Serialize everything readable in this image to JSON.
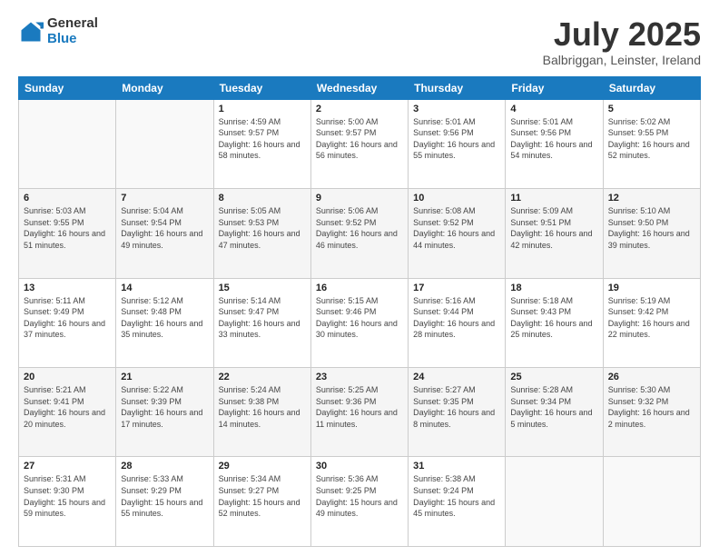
{
  "header": {
    "logo_general": "General",
    "logo_blue": "Blue",
    "month_year": "July 2025",
    "location": "Balbriggan, Leinster, Ireland"
  },
  "weekdays": [
    "Sunday",
    "Monday",
    "Tuesday",
    "Wednesday",
    "Thursday",
    "Friday",
    "Saturday"
  ],
  "weeks": [
    [
      {
        "day": "",
        "info": ""
      },
      {
        "day": "",
        "info": ""
      },
      {
        "day": "1",
        "info": "Sunrise: 4:59 AM\nSunset: 9:57 PM\nDaylight: 16 hours and 58 minutes."
      },
      {
        "day": "2",
        "info": "Sunrise: 5:00 AM\nSunset: 9:57 PM\nDaylight: 16 hours and 56 minutes."
      },
      {
        "day": "3",
        "info": "Sunrise: 5:01 AM\nSunset: 9:56 PM\nDaylight: 16 hours and 55 minutes."
      },
      {
        "day": "4",
        "info": "Sunrise: 5:01 AM\nSunset: 9:56 PM\nDaylight: 16 hours and 54 minutes."
      },
      {
        "day": "5",
        "info": "Sunrise: 5:02 AM\nSunset: 9:55 PM\nDaylight: 16 hours and 52 minutes."
      }
    ],
    [
      {
        "day": "6",
        "info": "Sunrise: 5:03 AM\nSunset: 9:55 PM\nDaylight: 16 hours and 51 minutes."
      },
      {
        "day": "7",
        "info": "Sunrise: 5:04 AM\nSunset: 9:54 PM\nDaylight: 16 hours and 49 minutes."
      },
      {
        "day": "8",
        "info": "Sunrise: 5:05 AM\nSunset: 9:53 PM\nDaylight: 16 hours and 47 minutes."
      },
      {
        "day": "9",
        "info": "Sunrise: 5:06 AM\nSunset: 9:52 PM\nDaylight: 16 hours and 46 minutes."
      },
      {
        "day": "10",
        "info": "Sunrise: 5:08 AM\nSunset: 9:52 PM\nDaylight: 16 hours and 44 minutes."
      },
      {
        "day": "11",
        "info": "Sunrise: 5:09 AM\nSunset: 9:51 PM\nDaylight: 16 hours and 42 minutes."
      },
      {
        "day": "12",
        "info": "Sunrise: 5:10 AM\nSunset: 9:50 PM\nDaylight: 16 hours and 39 minutes."
      }
    ],
    [
      {
        "day": "13",
        "info": "Sunrise: 5:11 AM\nSunset: 9:49 PM\nDaylight: 16 hours and 37 minutes."
      },
      {
        "day": "14",
        "info": "Sunrise: 5:12 AM\nSunset: 9:48 PM\nDaylight: 16 hours and 35 minutes."
      },
      {
        "day": "15",
        "info": "Sunrise: 5:14 AM\nSunset: 9:47 PM\nDaylight: 16 hours and 33 minutes."
      },
      {
        "day": "16",
        "info": "Sunrise: 5:15 AM\nSunset: 9:46 PM\nDaylight: 16 hours and 30 minutes."
      },
      {
        "day": "17",
        "info": "Sunrise: 5:16 AM\nSunset: 9:44 PM\nDaylight: 16 hours and 28 minutes."
      },
      {
        "day": "18",
        "info": "Sunrise: 5:18 AM\nSunset: 9:43 PM\nDaylight: 16 hours and 25 minutes."
      },
      {
        "day": "19",
        "info": "Sunrise: 5:19 AM\nSunset: 9:42 PM\nDaylight: 16 hours and 22 minutes."
      }
    ],
    [
      {
        "day": "20",
        "info": "Sunrise: 5:21 AM\nSunset: 9:41 PM\nDaylight: 16 hours and 20 minutes."
      },
      {
        "day": "21",
        "info": "Sunrise: 5:22 AM\nSunset: 9:39 PM\nDaylight: 16 hours and 17 minutes."
      },
      {
        "day": "22",
        "info": "Sunrise: 5:24 AM\nSunset: 9:38 PM\nDaylight: 16 hours and 14 minutes."
      },
      {
        "day": "23",
        "info": "Sunrise: 5:25 AM\nSunset: 9:36 PM\nDaylight: 16 hours and 11 minutes."
      },
      {
        "day": "24",
        "info": "Sunrise: 5:27 AM\nSunset: 9:35 PM\nDaylight: 16 hours and 8 minutes."
      },
      {
        "day": "25",
        "info": "Sunrise: 5:28 AM\nSunset: 9:34 PM\nDaylight: 16 hours and 5 minutes."
      },
      {
        "day": "26",
        "info": "Sunrise: 5:30 AM\nSunset: 9:32 PM\nDaylight: 16 hours and 2 minutes."
      }
    ],
    [
      {
        "day": "27",
        "info": "Sunrise: 5:31 AM\nSunset: 9:30 PM\nDaylight: 15 hours and 59 minutes."
      },
      {
        "day": "28",
        "info": "Sunrise: 5:33 AM\nSunset: 9:29 PM\nDaylight: 15 hours and 55 minutes."
      },
      {
        "day": "29",
        "info": "Sunrise: 5:34 AM\nSunset: 9:27 PM\nDaylight: 15 hours and 52 minutes."
      },
      {
        "day": "30",
        "info": "Sunrise: 5:36 AM\nSunset: 9:25 PM\nDaylight: 15 hours and 49 minutes."
      },
      {
        "day": "31",
        "info": "Sunrise: 5:38 AM\nSunset: 9:24 PM\nDaylight: 15 hours and 45 minutes."
      },
      {
        "day": "",
        "info": ""
      },
      {
        "day": "",
        "info": ""
      }
    ]
  ]
}
